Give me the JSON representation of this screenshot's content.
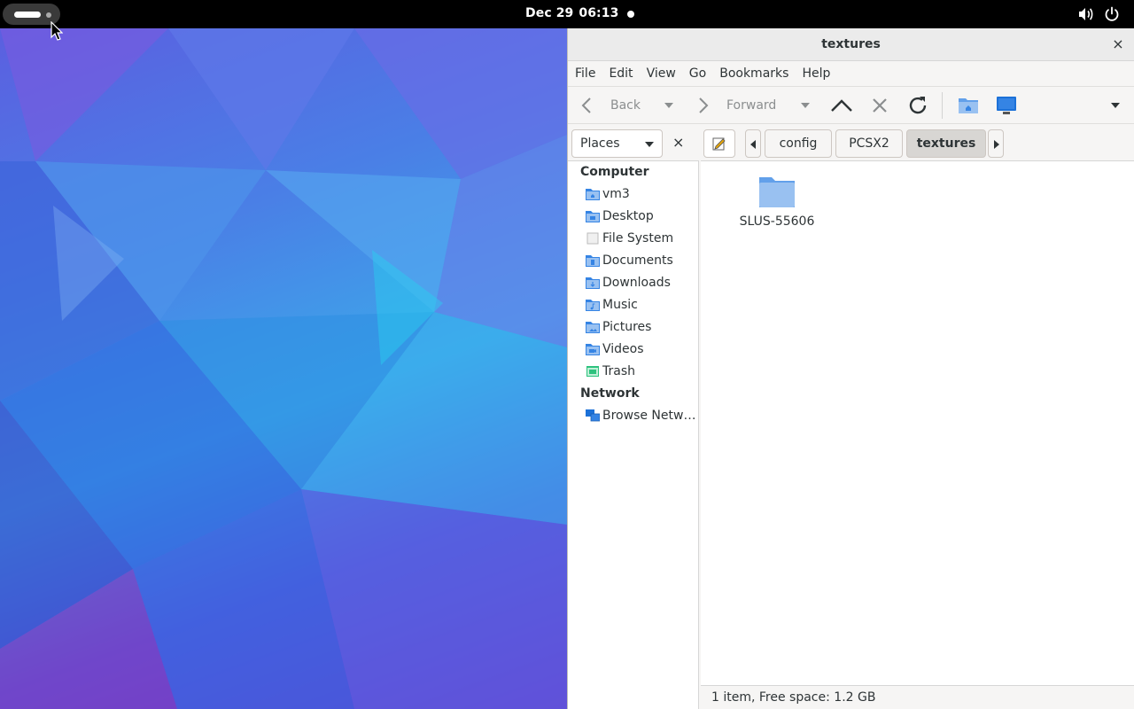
{
  "topbar": {
    "date": "Dec 29",
    "time": "06:13",
    "icons": [
      "activities-pill",
      "volume-icon",
      "power-icon"
    ]
  },
  "window": {
    "title": "textures",
    "close_glyph": "×"
  },
  "menubar": {
    "items": [
      "File",
      "Edit",
      "View",
      "Go",
      "Bookmarks",
      "Help"
    ]
  },
  "toolbar": {
    "back_label": "Back",
    "forward_label": "Forward"
  },
  "location": {
    "places_label": "Places",
    "close_glyph": "×",
    "breadcrumbs": [
      "config",
      "PCSX2",
      "textures"
    ],
    "active_crumb": "textures"
  },
  "sidebar": {
    "computer_heading": "Computer",
    "items": [
      {
        "label": "vm3",
        "icon": "home-folder-icon"
      },
      {
        "label": "Desktop",
        "icon": "desktop-folder-icon"
      },
      {
        "label": "File System",
        "icon": "drive-icon"
      },
      {
        "label": "Documents",
        "icon": "documents-folder-icon"
      },
      {
        "label": "Downloads",
        "icon": "downloads-folder-icon"
      },
      {
        "label": "Music",
        "icon": "music-folder-icon"
      },
      {
        "label": "Pictures",
        "icon": "pictures-folder-icon"
      },
      {
        "label": "Videos",
        "icon": "videos-folder-icon"
      },
      {
        "label": "Trash",
        "icon": "trash-icon"
      }
    ],
    "network_heading": "Network",
    "network_items": [
      {
        "label": "Browse Netw…",
        "icon": "network-icon"
      }
    ]
  },
  "files": [
    {
      "name": "SLUS-55606",
      "type": "folder"
    }
  ],
  "status": {
    "text": "1 item, Free space: 1.2 GB"
  },
  "colors": {
    "folder_blue": "#62a0ea",
    "accent_blue": "#3584e4",
    "topbar": "#000000"
  }
}
